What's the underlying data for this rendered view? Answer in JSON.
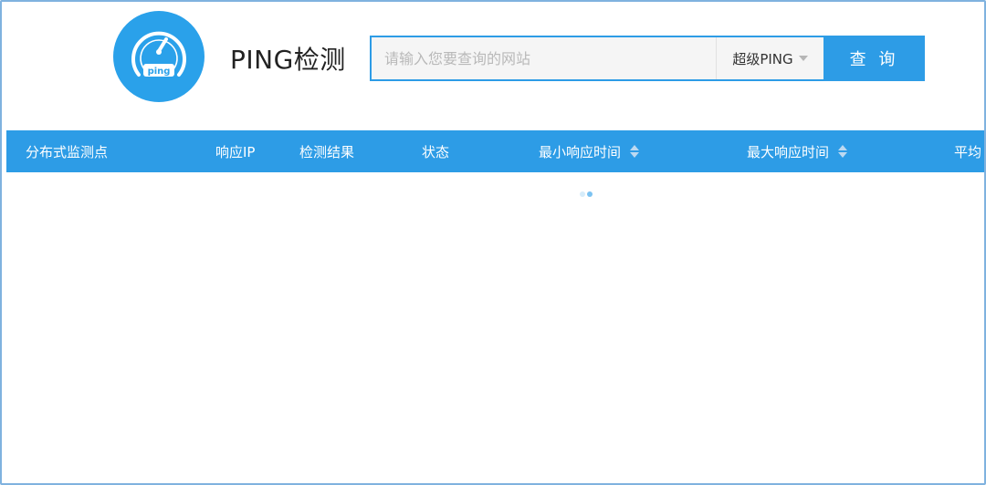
{
  "header": {
    "title": "PING检测",
    "logo_text": "ping"
  },
  "search": {
    "placeholder": "请输入您要查询的网站",
    "value": "",
    "mode_label": "超级PING",
    "submit_label": "查 询"
  },
  "table": {
    "columns": [
      {
        "label": "分布式监测点",
        "sortable": false
      },
      {
        "label": "响应IP",
        "sortable": false
      },
      {
        "label": "检测结果",
        "sortable": false
      },
      {
        "label": "状态",
        "sortable": false
      },
      {
        "label": "最小响应时间",
        "sortable": true
      },
      {
        "label": "最大响应时间",
        "sortable": true
      },
      {
        "label": "平均",
        "sortable": false
      }
    ],
    "rows": []
  },
  "colors": {
    "accent": "#2d9ce6",
    "logo": "#2aa1ea",
    "border": "#7fb2df"
  },
  "icons": [
    "speedometer-icon",
    "chevron-down-icon",
    "sort-icon",
    "loading-spinner-icon"
  ]
}
